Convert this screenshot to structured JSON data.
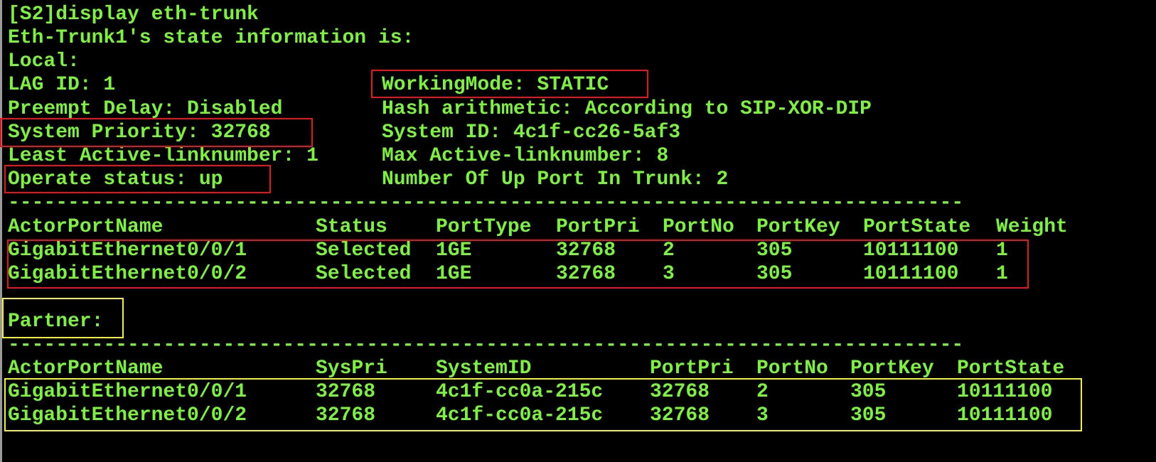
{
  "terminal": {
    "colors": {
      "background": "#000000",
      "text": "#7cf33a",
      "highlight_red": "#e8141b",
      "highlight_yellow": "#f5f22a"
    },
    "command": "[S2]display eth-trunk",
    "state_header": "Eth-Trunk1's state information is:",
    "local_label": "Local:",
    "lag_id": "LAG ID: 1",
    "working_mode": "WorkingMode: STATIC",
    "preempt_delay": "Preempt Delay: Disabled",
    "hash_arithmetic": "Hash arithmetic: According to SIP-XOR-DIP",
    "system_priority": "System Priority: 32768",
    "system_id": "System ID: 4c1f-cc26-5af3",
    "least_active": "Least Active-linknumber: 1",
    "max_active": "Max Active-linknumber: 8",
    "operate_status": "Operate status: up",
    "up_ports": "Number Of Up Port In Trunk: 2",
    "separator": "--------------------------------------------------------------------------------",
    "local_table": {
      "headers": [
        "ActorPortName",
        "Status",
        "PortType",
        "PortPri",
        "PortNo",
        "PortKey",
        "PortState",
        "Weight"
      ],
      "rows": [
        [
          "GigabitEthernet0/0/1",
          "Selected",
          "1GE",
          "32768",
          "2",
          "305",
          "10111100",
          "1"
        ],
        [
          "GigabitEthernet0/0/2",
          "Selected",
          "1GE",
          "32768",
          "3",
          "305",
          "10111100",
          "1"
        ]
      ]
    },
    "partner_label": "Partner:",
    "partner_table": {
      "headers": [
        "ActorPortName",
        "SysPri",
        "SystemID",
        "PortPri",
        "PortNo",
        "PortKey",
        "PortState"
      ],
      "rows": [
        [
          "GigabitEthernet0/0/1",
          "32768",
          "4c1f-cc0a-215c",
          "32768",
          "2",
          "305",
          "10111100"
        ],
        [
          "GigabitEthernet0/0/2",
          "32768",
          "4c1f-cc0a-215c",
          "32768",
          "3",
          "305",
          "10111100"
        ]
      ]
    }
  }
}
